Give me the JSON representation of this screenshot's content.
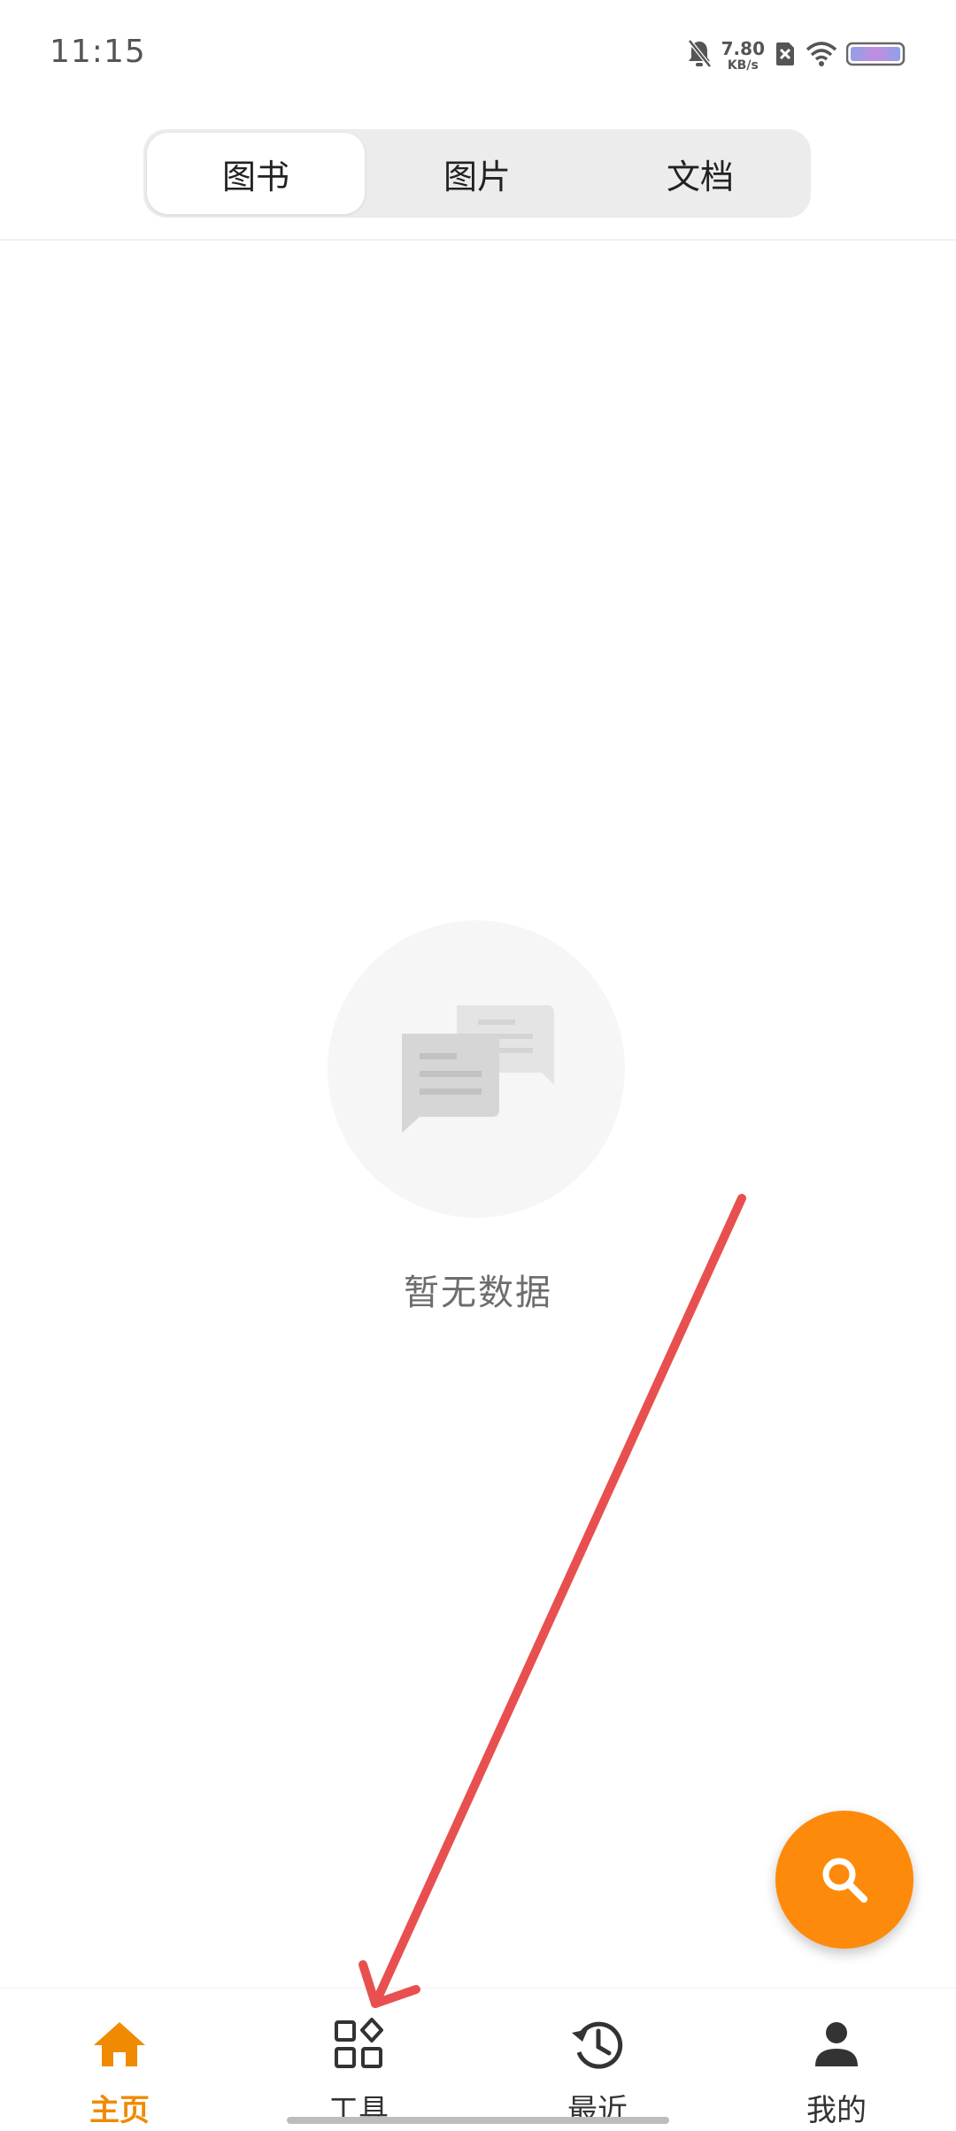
{
  "status_bar": {
    "time": "11:15",
    "net_speed_value": "7.80",
    "net_speed_unit": "KB/s",
    "icons": [
      "bell-off-icon",
      "sim-x-icon",
      "wifi-icon",
      "battery-icon"
    ]
  },
  "tabs": [
    {
      "label": "图书",
      "active": true
    },
    {
      "label": "图片",
      "active": false
    },
    {
      "label": "文档",
      "active": false
    }
  ],
  "empty_state": {
    "icon": "chat-bubbles-icon",
    "text": "暂无数据"
  },
  "fab": {
    "icon": "search-icon",
    "color": "#fd8a0a"
  },
  "bottom_nav": {
    "items": [
      {
        "label": "主页",
        "icon": "home-icon",
        "active": true
      },
      {
        "label": "工具",
        "icon": "tools-grid-icon",
        "active": false
      },
      {
        "label": "最近",
        "icon": "history-icon",
        "active": false
      },
      {
        "label": "我的",
        "icon": "person-icon",
        "active": false
      }
    ],
    "active_color": "#f08a00"
  },
  "annotation": {
    "type": "arrow",
    "color": "#e8504f",
    "points_to": "工具"
  }
}
